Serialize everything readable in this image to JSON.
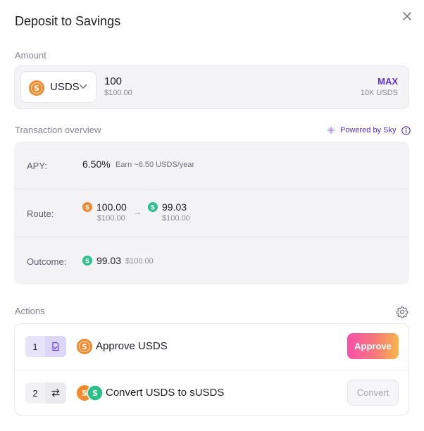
{
  "dialog": {
    "title": "Deposit to Savings",
    "close_icon": "close-icon"
  },
  "amount": {
    "label": "Amount",
    "token": "USDS",
    "value": "100",
    "value_usd": "$100.00",
    "max_label": "MAX",
    "balance": "10K USDS"
  },
  "overview": {
    "label": "Transaction overview",
    "powered_by": "Powered by Sky",
    "apy_label": "APY:",
    "apy_value": "6.50%",
    "apy_note": "Earn ~6.50 USDS/year",
    "route_label": "Route:",
    "route_from_amount": "100.00",
    "route_from_usd": "$100.00",
    "route_arrow": "→",
    "route_to_amount": "99.03",
    "route_to_usd": "$100.00",
    "outcome_label": "Outcome:",
    "outcome_amount": "99.03",
    "outcome_usd": "$100.00"
  },
  "actions": {
    "label": "Actions",
    "steps": [
      {
        "number": "1",
        "label": "Approve USDS",
        "button": "Approve",
        "icon": "approve-document-icon",
        "state": "active"
      },
      {
        "number": "2",
        "label": "Convert USDS to sUSDS",
        "button": "Convert",
        "icon": "swap-arrows-icon",
        "state": "disabled"
      }
    ]
  },
  "colors": {
    "accent": "#5a2fd8",
    "usds_coin": "#f08a2c",
    "susds_coin": "#2cc08a",
    "approve_gradient_start": "#f94fa9",
    "approve_gradient_end": "#f7b64a"
  }
}
